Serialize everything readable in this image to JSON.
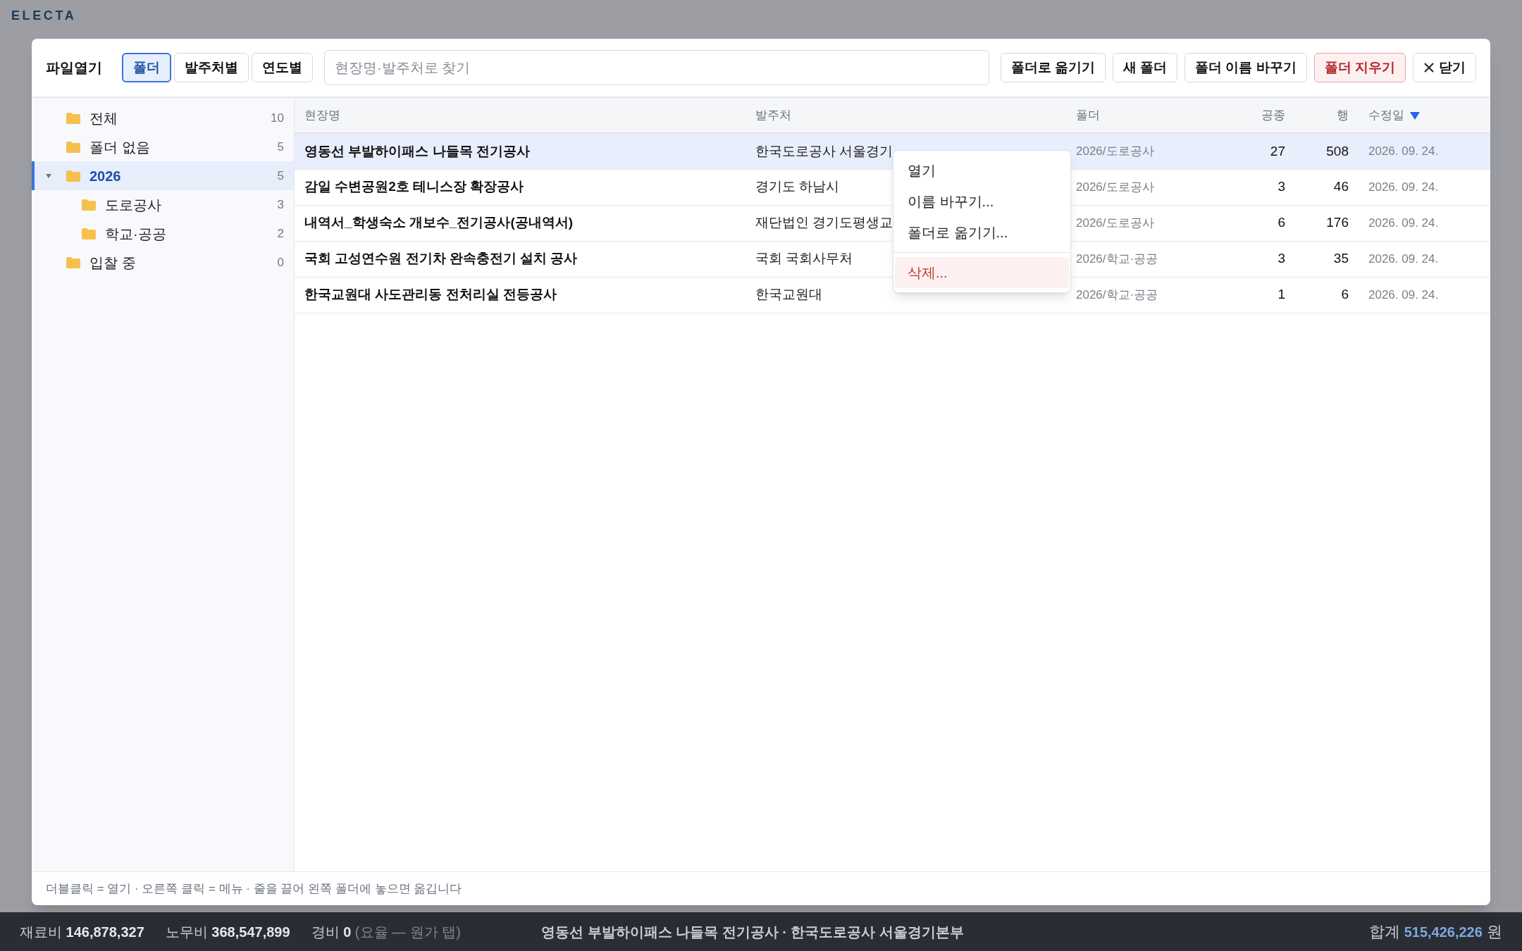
{
  "app": {
    "logo": "ELECTA"
  },
  "dialog": {
    "title": "파일열기",
    "view_tabs": [
      {
        "label": "폴더",
        "selected": true
      },
      {
        "label": "발주처별",
        "selected": false
      },
      {
        "label": "연도별",
        "selected": false
      }
    ],
    "search": {
      "placeholder": "현장명·발주처로 찾기"
    },
    "actions": [
      {
        "label": "폴더로 옮기기",
        "kind": "default"
      },
      {
        "label": "새 폴더",
        "kind": "default"
      },
      {
        "label": "폴더 이름 바꾸기",
        "kind": "default"
      },
      {
        "label": "폴더 지우기",
        "kind": "danger"
      },
      {
        "label": "닫기",
        "kind": "close"
      }
    ],
    "folders": [
      {
        "label": "전체",
        "count": "10",
        "selected": false
      },
      {
        "label": "폴더 없음",
        "count": "5",
        "selected": false
      },
      {
        "label": "2026",
        "count": "5",
        "selected": true,
        "expanded": true,
        "children": [
          {
            "label": "도로공사",
            "count": "3",
            "selected": false
          },
          {
            "label": "학교·공공",
            "count": "2",
            "selected": false
          }
        ]
      },
      {
        "label": "입찰 중",
        "count": "0",
        "selected": false
      }
    ],
    "table": {
      "columns": [
        {
          "label": "현장명",
          "sorted": false
        },
        {
          "label": "발주처",
          "sorted": false
        },
        {
          "label": "폴더",
          "sorted": false
        },
        {
          "label": "공종",
          "sorted": false
        },
        {
          "label": "행",
          "sorted": false
        },
        {
          "label": "수정일",
          "sorted": true
        }
      ],
      "rows": [
        {
          "selected": true,
          "cells": [
            "영동선 부발하이패스 나들목 전기공사",
            "한국도로공사 서울경기",
            "2026/도로공사",
            "27",
            "508",
            "2026. 09. 24."
          ]
        },
        {
          "selected": false,
          "cells": [
            "감일 수변공원2호 테니스장 확장공사",
            "경기도 하남시",
            "2026/도로공사",
            "3",
            "46",
            "2026. 09. 24."
          ]
        },
        {
          "selected": false,
          "cells": [
            "내역서_학생숙소 개보수_전기공사(공내역서)",
            "재단법인 경기도평생교",
            "2026/도로공사",
            "6",
            "176",
            "2026. 09. 24."
          ]
        },
        {
          "selected": false,
          "cells": [
            "국회 고성연수원 전기차 완속충전기 설치 공사",
            "국회 국회사무처",
            "2026/학교·공공",
            "3",
            "35",
            "2026. 09. 24."
          ]
        },
        {
          "selected": false,
          "cells": [
            "한국교원대 사도관리동 전처리실 전등공사",
            "한국교원대",
            "2026/학교·공공",
            "1",
            "6",
            "2026. 09. 24."
          ]
        }
      ]
    },
    "context_menu": [
      {
        "kind": "item",
        "label": "열기",
        "danger": false,
        "selected": false
      },
      {
        "kind": "item",
        "label": "이름 바꾸기...",
        "danger": false,
        "selected": false
      },
      {
        "kind": "item",
        "label": "폴더로 옮기기...",
        "danger": false,
        "selected": false
      },
      {
        "kind": "separator"
      },
      {
        "kind": "item",
        "label": "삭제...",
        "danger": true,
        "selected": true
      }
    ],
    "hint": "더블클릭 = 열기 · 오른쪽 클릭 = 메뉴 · 줄을 끌어 왼쪽 폴더에 놓으면 옮깁니다"
  },
  "status_bar": {
    "costs": [
      {
        "label": "재료비",
        "value": "146,878,327"
      },
      {
        "label": "노무비",
        "value": "368,547,899"
      },
      {
        "label": "경비",
        "value": "0",
        "note": "(요율 — 원가 탭)"
      }
    ],
    "project": "영동선 부발하이패스 나들목 전기공사 · 한국도로공사 서울경기본부",
    "total": {
      "label": "합계",
      "value": "515,426,226",
      "unit": "원"
    }
  }
}
